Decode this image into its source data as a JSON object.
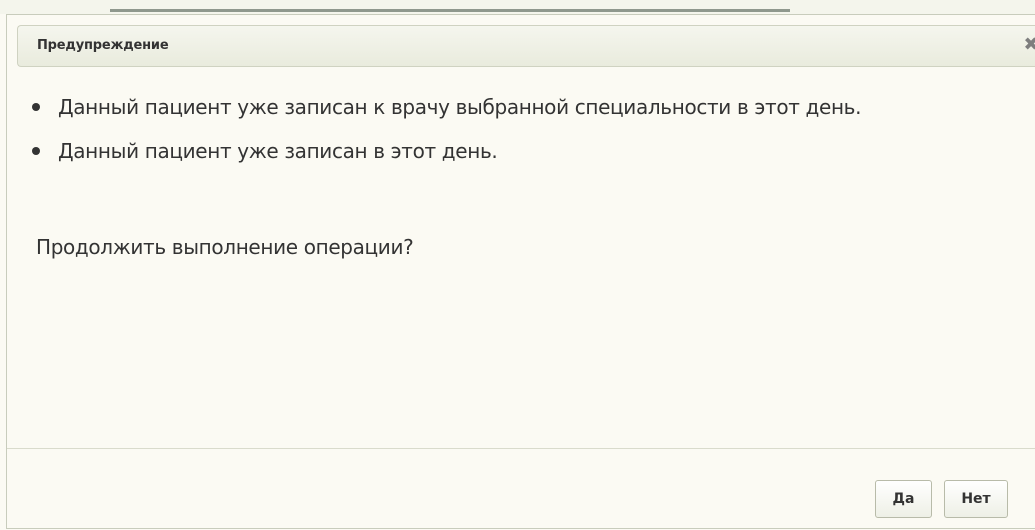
{
  "dialog": {
    "title": "Предупреждение",
    "close_icon": "close-icon",
    "messages": [
      "Данный пациент уже записан к врачу выбранной специальности в этот день.",
      "Данный пациент уже записан в этот день."
    ],
    "question": "Продолжить выполнение операции?",
    "buttons": {
      "yes_label": "Да",
      "no_label": "Нет"
    }
  },
  "colors": {
    "background": "#fbfaf3",
    "text": "#333333",
    "titlebar": "#eceee2"
  }
}
